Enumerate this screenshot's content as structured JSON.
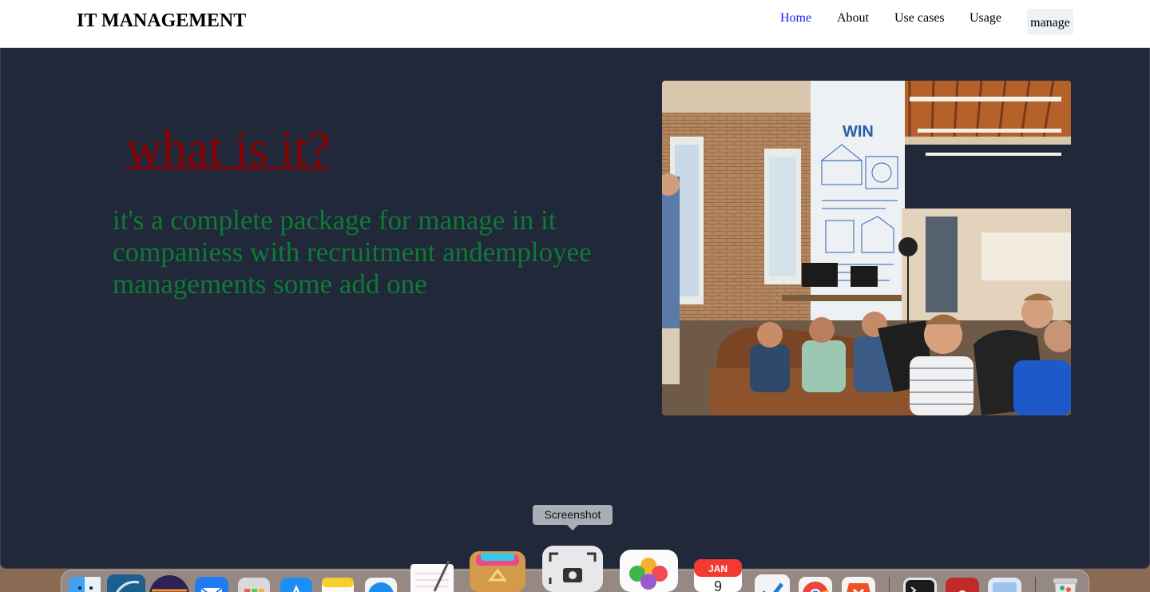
{
  "header": {
    "brand": "IT MANAGEMENT",
    "nav": [
      {
        "label": "Home",
        "active": true
      },
      {
        "label": "About",
        "active": false
      },
      {
        "label": "Use cases",
        "active": false
      },
      {
        "label": "Usage",
        "active": false
      }
    ],
    "button_label": "manage"
  },
  "hero": {
    "title": "what is it?",
    "description": "it's a complete package for manage in it companiess with recruitment andemployee managements some add one",
    "image": "office-team-meeting-photo"
  },
  "dock": {
    "tooltip": "Screenshot",
    "calendar_month": "JAN",
    "calendar_day": "9",
    "apps": [
      "finder-icon",
      "mysql-workbench-icon",
      "eclipse-icon",
      "mail-icon",
      "launchpad-icon",
      "app-store-icon",
      "notes-icon",
      "safari-icon",
      "textedit-icon",
      "archive-utility-icon",
      "screenshot-icon",
      "photos-icon",
      "calendar-icon",
      "vscode-icon",
      "chrome-icon",
      "brave-icon",
      "terminal-icon",
      "acrobat-icon",
      "preview-icon",
      "trash-icon"
    ]
  },
  "colors": {
    "hero_bg": "#202839",
    "title": "#8b0000",
    "description": "#0f7a34",
    "nav_active": "#1a1aff"
  }
}
